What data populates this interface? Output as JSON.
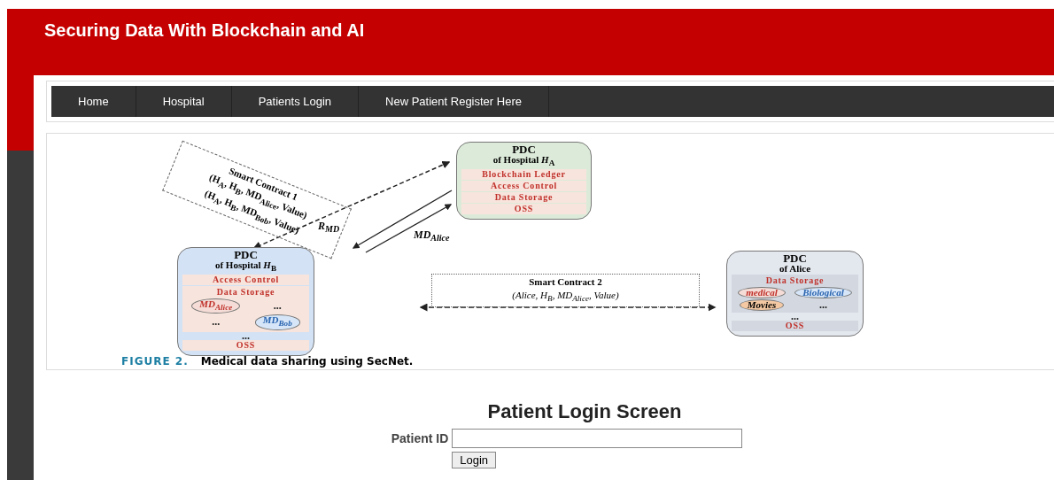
{
  "header": {
    "title": "Securing Data With Blockchain and AI"
  },
  "nav": {
    "items": [
      "Home",
      "Hospital",
      "Patients Login",
      "New Patient Register Here"
    ]
  },
  "figure": {
    "nodes": [
      {
        "title": "PDC",
        "subtitle": "of Hospital *H*$_{A}$",
        "color": "#dcebd9",
        "sections": [
          {
            "kind": "bar",
            "text": "Blockchain Ledger"
          },
          {
            "kind": "bar",
            "text": "Access Control"
          },
          {
            "kind": "bar",
            "text": "Data Storage"
          },
          {
            "kind": "bar",
            "text": "OSS"
          }
        ]
      },
      {
        "title": "PDC",
        "subtitle": "of Hospital *H*$_{B}$",
        "color": "#d3e2f4",
        "sections": [
          {
            "kind": "bar",
            "text": "Access Control"
          },
          {
            "kind": "storage",
            "text": "Data Storage",
            "bubbles": [
              {
                "text": "MD$_{Alice}$",
                "color": "#f5dcd6"
              },
              {
                "text": "MD$_{Bob}$",
                "color": "#d6e6f8"
              }
            ],
            "dots": [
              "...",
              "..."
            ]
          },
          {
            "kind": "dots",
            "text": "..."
          },
          {
            "kind": "bar",
            "text": "OSS"
          }
        ]
      },
      {
        "title": "PDC",
        "subtitle": "of Alice",
        "color": "#e3e7ee",
        "sections": [
          {
            "kind": "storage",
            "text": "Data Storage",
            "bubbles": [
              {
                "text": "medical",
                "color": "#f5dcd6"
              },
              {
                "text": "Biological",
                "color": "#d6e6f8"
              },
              {
                "text": "Movies",
                "color": "#f3c8a2"
              }
            ],
            "dots": [
              "..."
            ]
          },
          {
            "kind": "dots",
            "text": "..."
          },
          {
            "kind": "bar",
            "text": "OSS"
          }
        ]
      }
    ],
    "contracts": [
      {
        "title": "Smart Contract 1",
        "lines": [
          "(H$_{A}$, H$_{B}$, MD$_{Alice}$, Value)",
          "(H$_{A}$, H$_{B}$, MD$_{Bob}$, Value)"
        ]
      },
      {
        "title": "Smart Contract 2",
        "lines": [
          "(Alice, H$_{B}$, MD$_{Alice}$, Value)"
        ]
      }
    ],
    "arrow_labels": [
      "R$_{MD}$",
      "MD$_{Alice}$"
    ],
    "caption": {
      "label": "FIGURE 2.",
      "text": "Medical data sharing using SecNet."
    }
  },
  "login": {
    "title": "Patient Login Screen",
    "field_label": "Patient ID",
    "button": "Login"
  }
}
